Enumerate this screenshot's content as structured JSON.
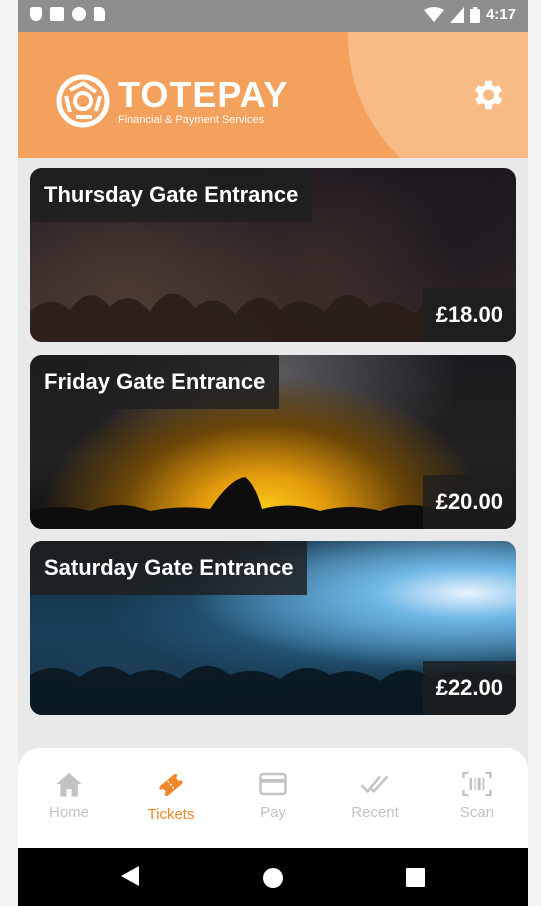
{
  "status_bar": {
    "time": "4:17",
    "left_icons": [
      "shield-icon",
      "a-icon",
      "circle-icon",
      "sd-card-icon"
    ],
    "right_icons": [
      "wifi-icon",
      "signal-icon",
      "battery-icon"
    ]
  },
  "header": {
    "brand": "TOTEPAY",
    "tagline": "Financial & Payment Services",
    "settings_icon": "gear-icon",
    "accent_color": "#f4a15e"
  },
  "tickets": [
    {
      "title": "Thursday Gate Entrance",
      "price": "£18.00"
    },
    {
      "title": "Friday Gate Entrance",
      "price": "£20.00"
    },
    {
      "title": "Saturday Gate Entrance",
      "price": "£22.00"
    }
  ],
  "bottom_nav": {
    "active": "Tickets",
    "items": [
      {
        "label": "Home",
        "icon": "home-icon"
      },
      {
        "label": "Tickets",
        "icon": "ticket-icon"
      },
      {
        "label": "Pay",
        "icon": "card-icon"
      },
      {
        "label": "Recent",
        "icon": "checkmarks-icon"
      },
      {
        "label": "Scan",
        "icon": "barcode-icon"
      }
    ]
  },
  "android_nav": [
    "back-icon",
    "home-circle-icon",
    "recents-icon"
  ]
}
